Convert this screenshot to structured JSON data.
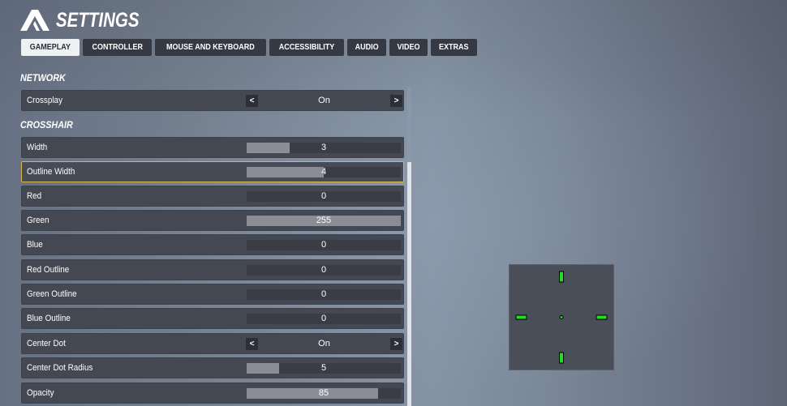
{
  "header": {
    "title": "SETTINGS",
    "logo": "game-logo-icon"
  },
  "tabs": [
    {
      "label": "GAMEPLAY",
      "active": true
    },
    {
      "label": "CONTROLLER",
      "active": false
    },
    {
      "label": "MOUSE AND KEYBOARD",
      "active": false
    },
    {
      "label": "ACCESSIBILITY",
      "active": false
    },
    {
      "label": "AUDIO",
      "active": false
    },
    {
      "label": "VIDEO",
      "active": false
    },
    {
      "label": "EXTRAS",
      "active": false
    }
  ],
  "sections": {
    "network": {
      "title": "NETWORK",
      "crossplay": {
        "label": "Crossplay",
        "value": "On",
        "prev_icon": "<",
        "next_icon": ">"
      }
    },
    "crosshair": {
      "title": "CROSSHAIR",
      "width": {
        "label": "Width",
        "value": "3",
        "fill_fraction": 0.28
      },
      "outline_width": {
        "label": "Outline Width",
        "value": "4",
        "fill_fraction": 0.5,
        "focused": true
      },
      "red": {
        "label": "Red",
        "value": "0",
        "fill_fraction": 0
      },
      "green": {
        "label": "Green",
        "value": "255",
        "fill_fraction": 1.0
      },
      "blue": {
        "label": "Blue",
        "value": "0",
        "fill_fraction": 0
      },
      "red_outline": {
        "label": "Red Outline",
        "value": "0",
        "fill_fraction": 0
      },
      "green_outline": {
        "label": "Green Outline",
        "value": "0",
        "fill_fraction": 0
      },
      "blue_outline": {
        "label": "Blue Outline",
        "value": "0",
        "fill_fraction": 0
      },
      "center_dot": {
        "label": "Center Dot",
        "value": "On",
        "prev_icon": "<",
        "next_icon": ">"
      },
      "center_dot_radius": {
        "label": "Center Dot Radius",
        "value": "5",
        "fill_fraction": 0.21
      },
      "opacity": {
        "label": "Opacity",
        "value": "85",
        "fill_fraction": 0.85
      }
    }
  },
  "preview": {
    "crosshair_color": "#22dd22",
    "outline_color": "#000000"
  },
  "colors": {
    "focus_border": "#d9b64a",
    "row_bg": "#444852",
    "slider_fill": "#8a8d95"
  }
}
